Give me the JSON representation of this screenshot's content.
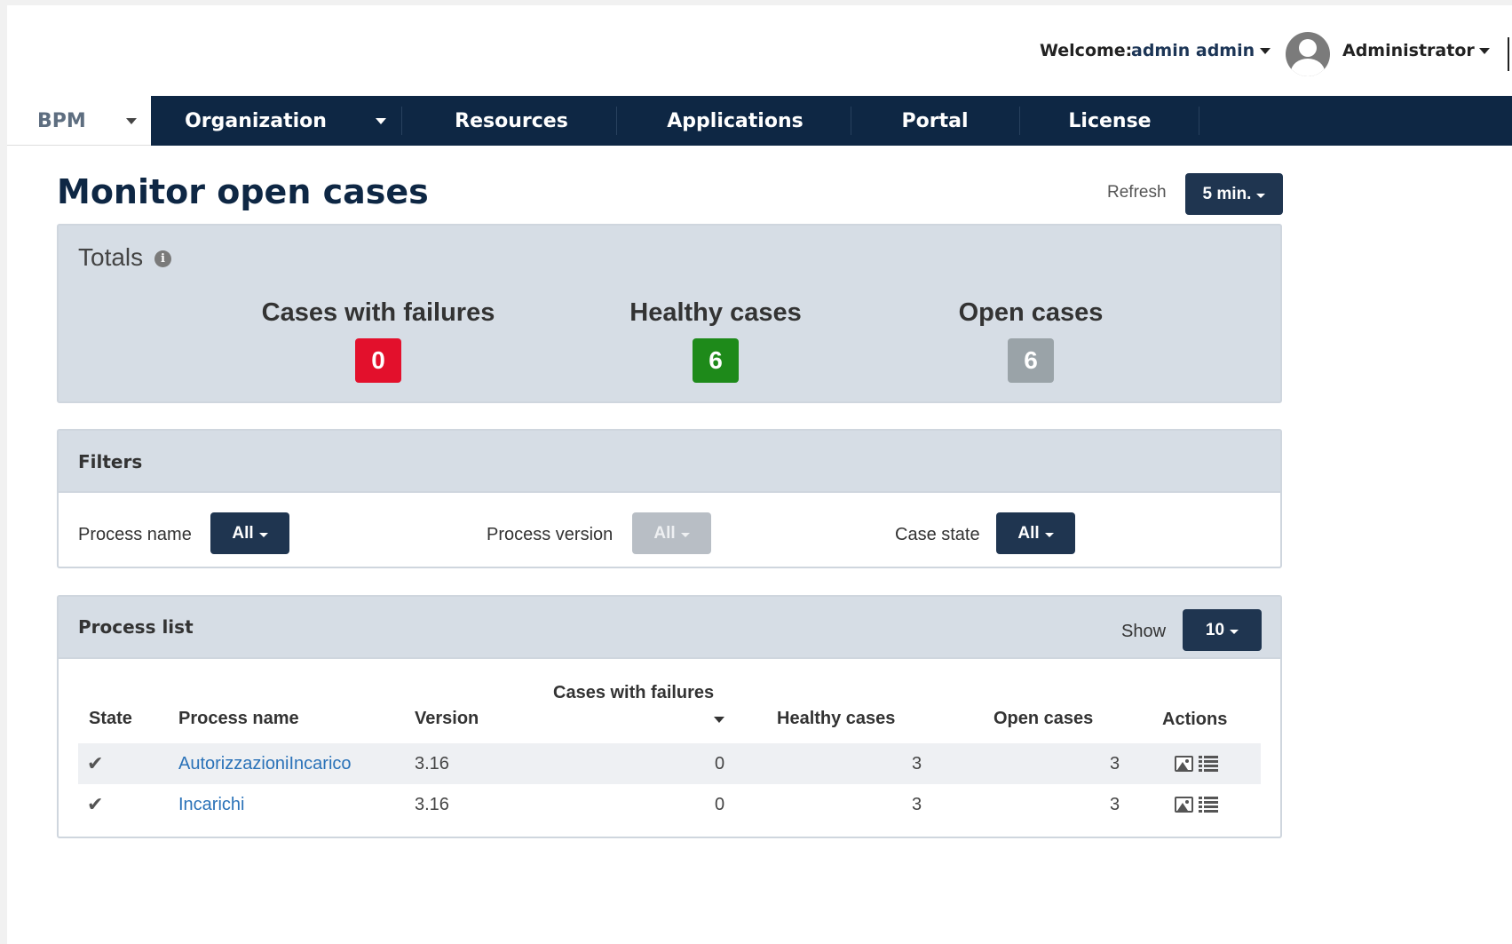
{
  "header": {
    "welcome_label": "Welcome:",
    "user_name": "admin admin",
    "role": "Administrator"
  },
  "nav": {
    "brand": "BPM",
    "items": [
      {
        "label": "Organization",
        "has_dropdown": true
      },
      {
        "label": "Resources"
      },
      {
        "label": "Applications"
      },
      {
        "label": "Portal"
      },
      {
        "label": "License"
      }
    ]
  },
  "page": {
    "title": "Monitor open cases",
    "refresh_label": "Refresh",
    "refresh_value": "5 min."
  },
  "totals": {
    "title": "Totals",
    "blocks": [
      {
        "label": "Cases with failures",
        "value": "0",
        "color": "#e3102c"
      },
      {
        "label": "Healthy cases",
        "value": "6",
        "color": "#1e8a1a"
      },
      {
        "label": "Open cases",
        "value": "6",
        "color": "#9aa3a8"
      }
    ]
  },
  "filters": {
    "title": "Filters",
    "process_name_label": "Process name",
    "process_name_value": "All",
    "process_version_label": "Process version",
    "process_version_value": "All",
    "case_state_label": "Case state",
    "case_state_value": "All"
  },
  "process_list": {
    "title": "Process list",
    "show_label": "Show",
    "show_value": "10",
    "columns": {
      "state": "State",
      "process_name": "Process name",
      "version": "Version",
      "failures": "Cases with failures",
      "healthy": "Healthy cases",
      "open": "Open cases",
      "actions": "Actions"
    },
    "rows": [
      {
        "name": "AutorizzazioniIncarico",
        "version": "3.16",
        "failures": "0",
        "healthy": "3",
        "open": "3"
      },
      {
        "name": "Incarichi",
        "version": "3.16",
        "failures": "0",
        "healthy": "3",
        "open": "3"
      }
    ]
  }
}
